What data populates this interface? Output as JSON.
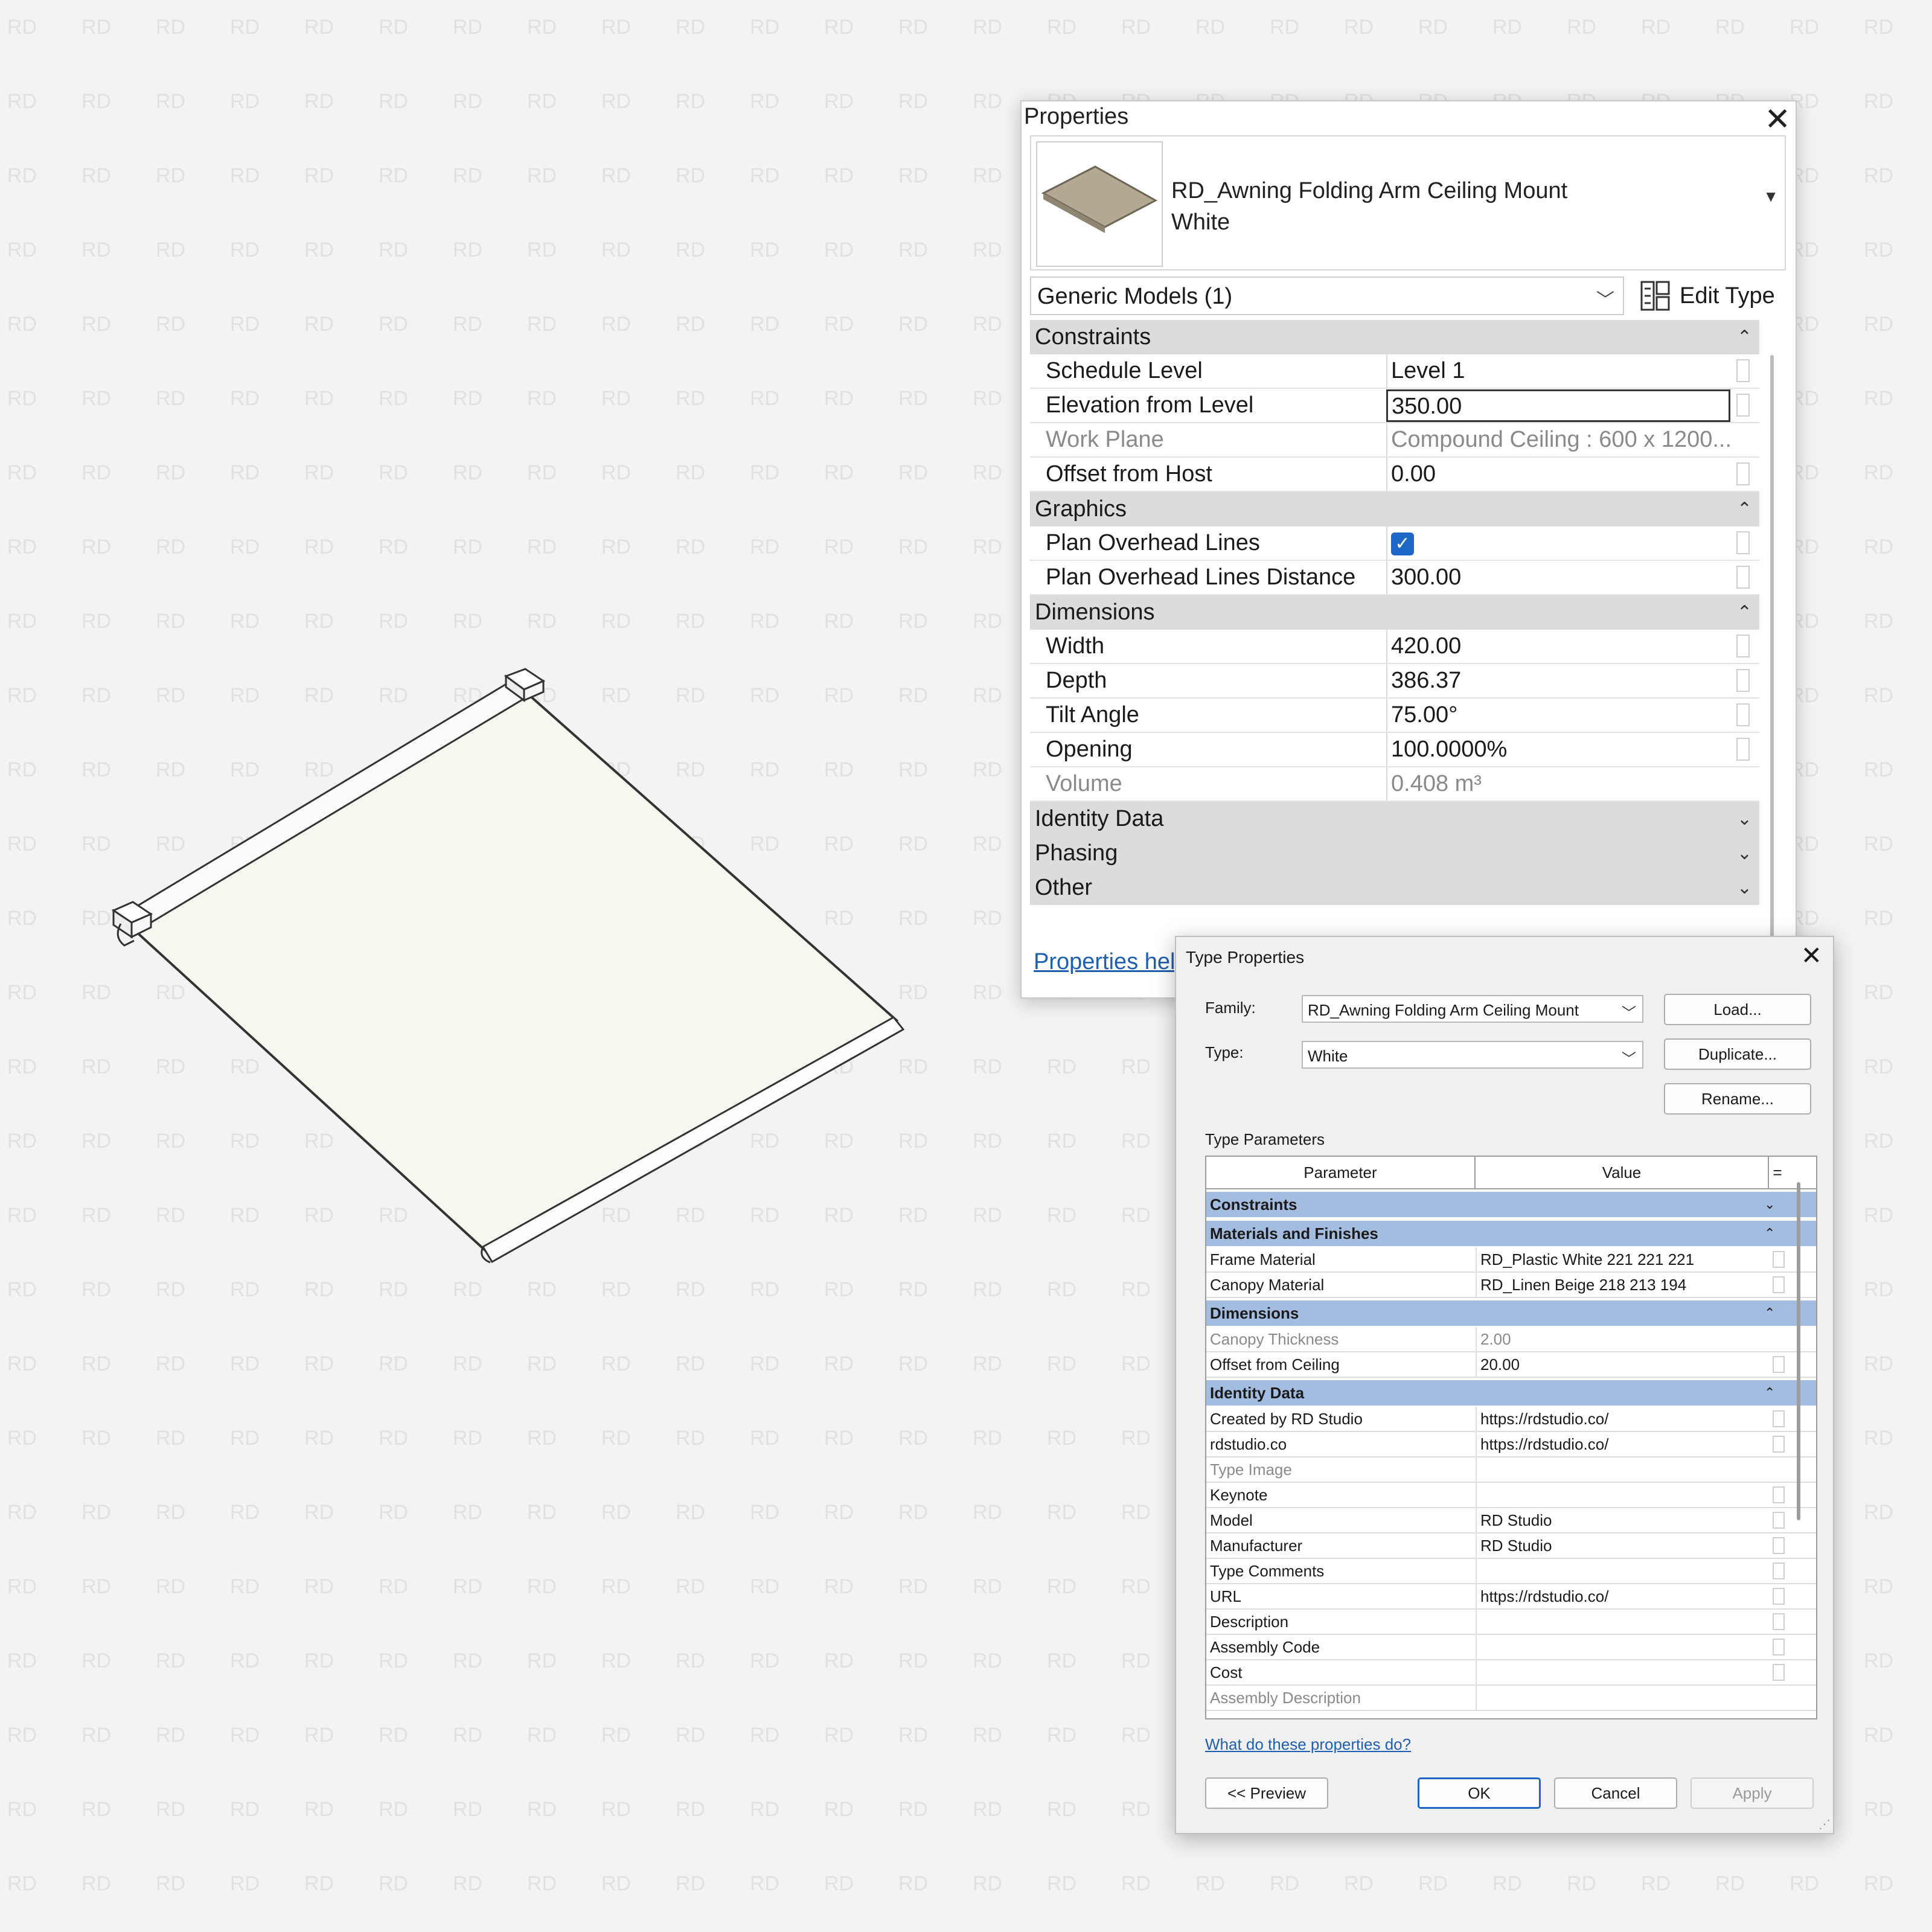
{
  "watermark_text": "RD",
  "properties_palette": {
    "title": "Properties",
    "family_name_line1": "RD_Awning Folding Arm Ceiling Mount",
    "family_name_line2": "White",
    "category_filter": "Generic Models (1)",
    "edit_type_label": "Edit Type",
    "help_link": "Properties help",
    "groups": [
      {
        "name": "Constraints",
        "expanded": true,
        "rows": [
          {
            "name": "Schedule Level",
            "value": "Level 1",
            "readonly": false
          },
          {
            "name": "Elevation from Level",
            "value": "350.00",
            "readonly": false,
            "active": true
          },
          {
            "name": "Work Plane",
            "value": "Compound Ceiling : 600 x 1200...",
            "readonly": true
          },
          {
            "name": "Offset from Host",
            "value": "0.00",
            "readonly": false
          }
        ]
      },
      {
        "name": "Graphics",
        "expanded": true,
        "rows": [
          {
            "name": "Plan Overhead Lines",
            "value": "",
            "checkbox": true,
            "checked": true,
            "readonly": false
          },
          {
            "name": "Plan Overhead Lines Distance",
            "value": "300.00",
            "readonly": false
          }
        ]
      },
      {
        "name": "Dimensions",
        "expanded": true,
        "rows": [
          {
            "name": "Width",
            "value": "420.00",
            "readonly": false
          },
          {
            "name": "Depth",
            "value": "386.37",
            "readonly": false
          },
          {
            "name": "Tilt Angle",
            "value": "75.00°",
            "readonly": false
          },
          {
            "name": "Opening",
            "value": "100.0000%",
            "readonly": false
          },
          {
            "name": "Volume",
            "value": "0.408 m³",
            "readonly": true
          }
        ]
      },
      {
        "name": "Identity Data",
        "expanded": false,
        "rows": []
      },
      {
        "name": "Phasing",
        "expanded": false,
        "rows": []
      },
      {
        "name": "Other",
        "expanded": false,
        "rows": []
      }
    ]
  },
  "type_properties": {
    "title": "Type Properties",
    "family_label": "Family:",
    "family_value": "RD_Awning Folding Arm Ceiling Mount",
    "type_label": "Type:",
    "type_value": "White",
    "load_button": "Load...",
    "duplicate_button": "Duplicate...",
    "rename_button": "Rename...",
    "type_parameters_label": "Type Parameters",
    "col_parameter": "Parameter",
    "col_value": "Value",
    "col_assoc": "=",
    "groups": [
      {
        "name": "Constraints",
        "expanded": false,
        "rows": []
      },
      {
        "name": "Materials and Finishes",
        "expanded": true,
        "rows": [
          {
            "name": "Frame Material",
            "value": "RD_Plastic White 221 221 221",
            "readonly": false
          },
          {
            "name": "Canopy Material",
            "value": "RD_Linen Beige 218 213 194",
            "readonly": false
          }
        ]
      },
      {
        "name": "Dimensions",
        "expanded": true,
        "rows": [
          {
            "name": "Canopy Thickness",
            "value": "2.00",
            "readonly": true
          },
          {
            "name": "Offset from Ceiling",
            "value": "20.00",
            "readonly": false
          }
        ]
      },
      {
        "name": "Identity Data",
        "expanded": true,
        "rows": [
          {
            "name": "Created by RD Studio",
            "value": "https://rdstudio.co/",
            "readonly": false
          },
          {
            "name": "rdstudio.co",
            "value": "https://rdstudio.co/",
            "readonly": false
          },
          {
            "name": "Type Image",
            "value": "",
            "readonly": true
          },
          {
            "name": "Keynote",
            "value": "",
            "readonly": false
          },
          {
            "name": "Model",
            "value": "RD Studio",
            "readonly": false
          },
          {
            "name": "Manufacturer",
            "value": "RD Studio",
            "readonly": false
          },
          {
            "name": "Type Comments",
            "value": "",
            "readonly": false
          },
          {
            "name": "URL",
            "value": "https://rdstudio.co/",
            "readonly": false
          },
          {
            "name": "Description",
            "value": "",
            "readonly": false
          },
          {
            "name": "Assembly Code",
            "value": "",
            "readonly": false
          },
          {
            "name": "Cost",
            "value": "",
            "readonly": false
          },
          {
            "name": "Assembly Description",
            "value": "",
            "readonly": true
          }
        ]
      }
    ],
    "help_link": "What do these properties do?",
    "preview_button": "<< Preview",
    "ok_button": "OK",
    "cancel_button": "Cancel",
    "apply_button": "Apply"
  }
}
